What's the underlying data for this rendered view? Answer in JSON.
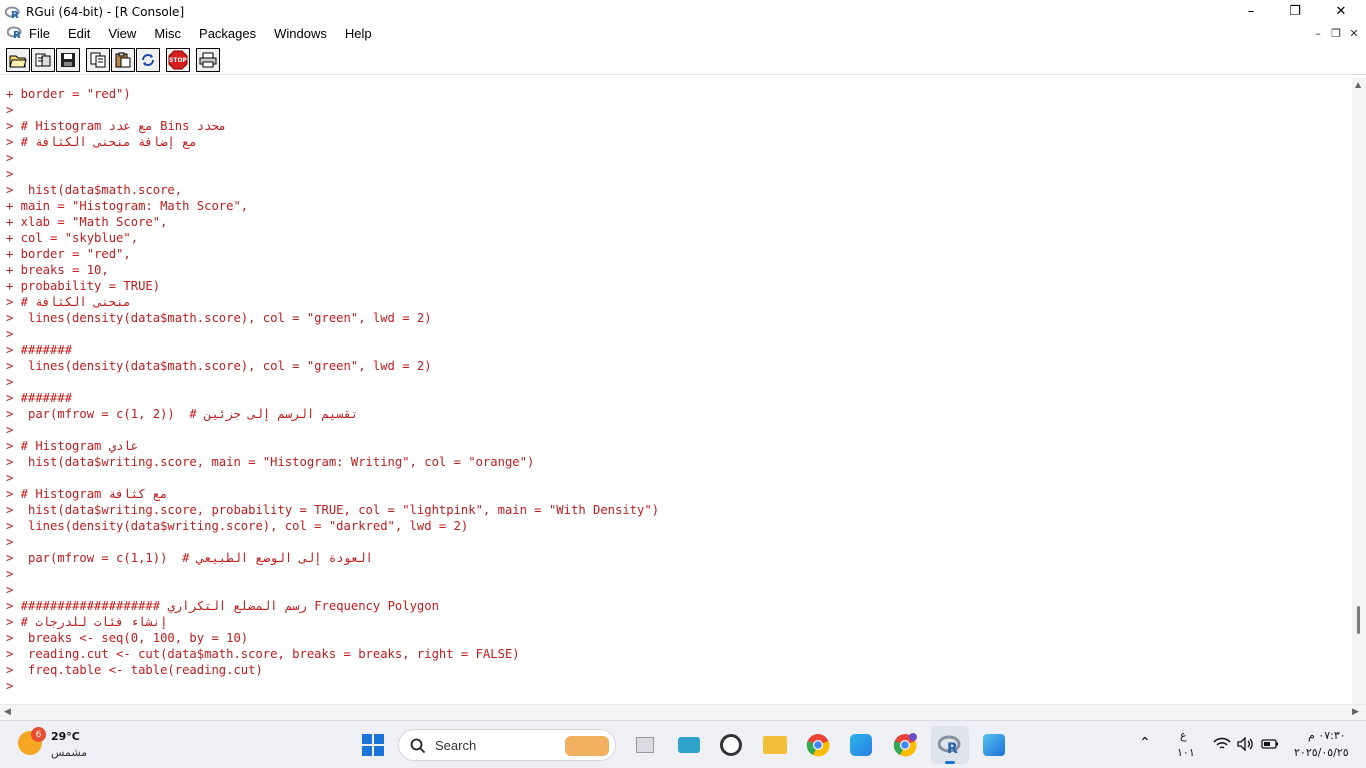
{
  "window": {
    "title": "RGui (64-bit) - [R Console]",
    "minimize": "–",
    "maximize": "❐",
    "close": "✕"
  },
  "menu": {
    "items": [
      "File",
      "Edit",
      "View",
      "Misc",
      "Packages",
      "Windows",
      "Help"
    ],
    "mdi_min": "–",
    "mdi_restore": "❐",
    "mdi_close": "✕"
  },
  "toolbar": {
    "icons": [
      "open-script-icon",
      "load-workspace-icon",
      "save-icon",
      "copy-icon",
      "paste-icon",
      "copy-paste-icon",
      "stop-icon",
      "print-icon"
    ],
    "stop_label": "STOP"
  },
  "console": {
    "text_color": "#c41b1b",
    "lines": [
      "+ border = \"red\")",
      ">",
      "> # Histogram مع عدد Bins محدد",
      "> # مع إضافة منحنى الكثافة",
      ">",
      ">",
      ">  hist(data$math.score,",
      "+ main = \"Histogram: Math Score\",",
      "+ xlab = \"Math Score\",",
      "+ col = \"skyblue\",",
      "+ border = \"red\",",
      "+ breaks = 10,",
      "+ probability = TRUE)",
      "> # منحنى الكثافة",
      ">  lines(density(data$math.score), col = \"green\", lwd = 2)",
      ">",
      "> #######",
      ">  lines(density(data$math.score), col = \"green\", lwd = 2)",
      ">",
      "> #######",
      ">  par(mfrow = c(1, 2))  # تقسيم الرسم إلى جزئين",
      ">",
      "> # Histogram عادي",
      ">  hist(data$writing.score, main = \"Histogram: Writing\", col = \"orange\")",
      ">",
      "> # Histogram مع كثافة",
      ">  hist(data$writing.score, probability = TRUE, col = \"lightpink\", main = \"With Density\")",
      ">  lines(density(data$writing.score), col = \"darkred\", lwd = 2)",
      ">",
      ">  par(mfrow = c(1,1))  # العودة إلى الوضع الطبيعي",
      ">",
      ">",
      "> ################### رسم المضلع التكراري Frequency Polygon",
      "> # إنشاء فئات للدرجات",
      ">  breaks <- seq(0, 100, by = 10)",
      ">  reading.cut <- cut(data$math.score, breaks = breaks, right = FALSE)",
      ">  freq.table <- table(reading.cut)",
      ">"
    ]
  },
  "taskbar": {
    "weather_temp": "29°C",
    "weather_desc": "مشمس",
    "weather_badge": "6",
    "search_label": "Search",
    "apps": [
      "start-icon",
      "search-icon",
      "file-explorer-icon",
      "clock-app-icon",
      "folder-icon",
      "chrome-icon",
      "store-icon",
      "chrome-profile-icon",
      "r-gui-icon",
      "paint-icon"
    ],
    "lang_top": "ع",
    "lang_bottom": "١٠١",
    "time": "٠٧:٣٠ م",
    "date": "٢٠٢٥/٠٥/٢٥"
  }
}
